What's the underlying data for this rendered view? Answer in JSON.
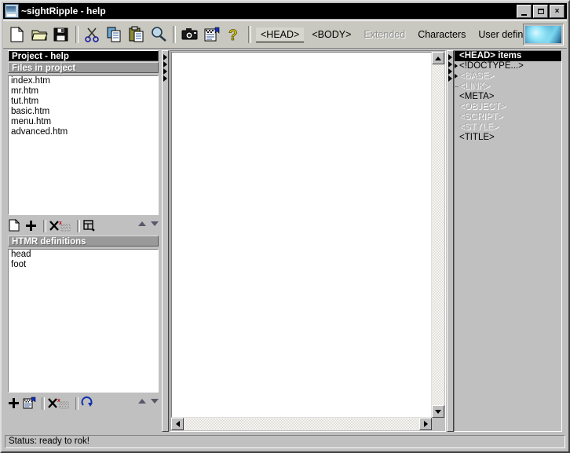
{
  "window": {
    "title": "~sightRipple - help",
    "icon": "app-logo-icon",
    "controls": {
      "minimize": "_",
      "maximize": "□",
      "close": "×"
    }
  },
  "toolbar": {
    "icons": [
      {
        "name": "new-file-icon",
        "label": "New"
      },
      {
        "name": "open-folder-icon",
        "label": "Open"
      },
      {
        "name": "save-disk-icon",
        "label": "Save"
      },
      {
        "name": "cut-scissors-icon",
        "label": "Cut"
      },
      {
        "name": "copy-icon",
        "label": "Copy"
      },
      {
        "name": "paste-clipboard-icon",
        "label": "Paste"
      },
      {
        "name": "find-magnifier-icon",
        "label": "Find"
      },
      {
        "name": "camera-icon",
        "label": "Snapshot"
      },
      {
        "name": "properties-icon",
        "label": "Properties"
      },
      {
        "name": "help-question-icon",
        "label": "Help"
      }
    ],
    "text_buttons": [
      {
        "label": "<HEAD>",
        "state": "selected"
      },
      {
        "label": "<BODY>",
        "state": "normal"
      },
      {
        "label": "Extended",
        "state": "disabled"
      },
      {
        "label": "Characters",
        "state": "normal"
      },
      {
        "label": "User defined",
        "state": "normal"
      }
    ],
    "logo": "sightripple-banner-image"
  },
  "project_panel": {
    "title": "Project - help",
    "section_header": "Files in project",
    "files": [
      "index.htm",
      "mr.htm",
      "tut.htm",
      "basic.htm",
      "menu.htm",
      "advanced.htm"
    ],
    "tools": [
      {
        "name": "new-document-icon",
        "label": "New file"
      },
      {
        "name": "add-plus-icon",
        "label": "Add file"
      },
      {
        "name": "delete-x-icon",
        "label": "Remove file"
      },
      {
        "name": "clear-list-icon",
        "label": "Clear"
      },
      {
        "name": "edit-properties-icon",
        "label": "Edit"
      }
    ],
    "scroll": {
      "up": "▲",
      "down": "▼"
    }
  },
  "definitions_panel": {
    "section_header": "HTMR definitions",
    "items": [
      "head",
      "foot"
    ],
    "tools": [
      {
        "name": "add-plus-icon",
        "label": "Add definition"
      },
      {
        "name": "new-definition-icon",
        "label": "New definition"
      },
      {
        "name": "delete-x-icon",
        "label": "Delete definition"
      },
      {
        "name": "clear-list-icon",
        "label": "Clear"
      },
      {
        "name": "refresh-icon",
        "label": "Refresh"
      }
    ],
    "scroll": {
      "up": "▲",
      "down": "▼"
    }
  },
  "editor": {
    "content": "",
    "scrollbars": {
      "up": "▲",
      "down": "▼",
      "left": "◄",
      "right": "►"
    }
  },
  "tree_panel": {
    "title": "<HEAD> items",
    "items": [
      {
        "label": "<!DOCTYPE...>",
        "state": "enabled",
        "marker": "expand"
      },
      {
        "label": "<BASE>",
        "state": "disabled",
        "marker": "expand"
      },
      {
        "label": "<LINK>",
        "state": "disabled",
        "marker": "dash"
      },
      {
        "label": "<META>",
        "state": "enabled",
        "marker": "none"
      },
      {
        "label": "<OBJECT>",
        "state": "disabled",
        "marker": "none"
      },
      {
        "label": "<SCRIPT>",
        "state": "disabled",
        "marker": "none"
      },
      {
        "label": "<STYLE>",
        "state": "disabled",
        "marker": "none"
      },
      {
        "label": "<TITLE>",
        "state": "enabled",
        "marker": "none"
      }
    ]
  },
  "statusbar": {
    "text": "Status: ready to rok!"
  },
  "colors": {
    "face": "#c0c0c0",
    "toolbar_face": "#c8c8c0",
    "title_bar": "#000000",
    "header_black": "#000000",
    "header_gray": "#9a9a9a",
    "listbox_bg": "#ffffff",
    "disabled_text": "#a8a8a8",
    "accent": "#000080"
  }
}
